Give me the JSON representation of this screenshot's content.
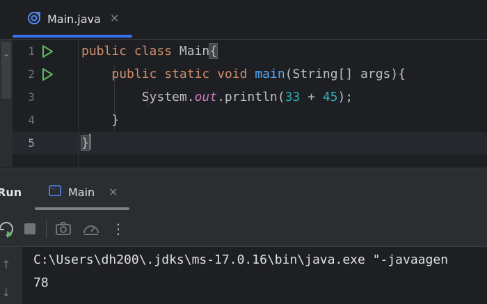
{
  "editor_tab": {
    "label": "Main.java",
    "close": "×"
  },
  "code_lines": [
    {
      "num": "1"
    },
    {
      "num": "2"
    },
    {
      "num": "3"
    },
    {
      "num": "4"
    },
    {
      "num": "5"
    }
  ],
  "code": {
    "l1_kw1": "public",
    "l1_kw2": "class",
    "l1_name": "Main",
    "l1_brace": "{",
    "l2_kw1": "public",
    "l2_kw2": "static",
    "l2_kw3": "void",
    "l2_fn": "main",
    "l2_params": "(String[] args){",
    "l3_sys": "System.",
    "l3_out": "out",
    "l3_call": ".println(",
    "l3_n1": "33",
    "l3_op": " + ",
    "l3_n2": "45",
    "l3_end": ");",
    "l4": "}",
    "l5": "}"
  },
  "run_panel": {
    "title": "Run",
    "tab_label": "Main",
    "tab_close": "×"
  },
  "toolbar": {
    "more": "⋮"
  },
  "console": {
    "line1": "C:\\Users\\dh200\\.jdks\\ms-17.0.16\\bin\\java.exe \"-javaagen",
    "line2": "78",
    "scroll_up": "↑",
    "scroll_down": "↓"
  },
  "colors": {
    "accent": "#3574f0",
    "keyword": "#cf8e6d",
    "function": "#56a8f5",
    "field": "#c77dbb",
    "number": "#2aacb8",
    "run_green": "#5fb865"
  }
}
